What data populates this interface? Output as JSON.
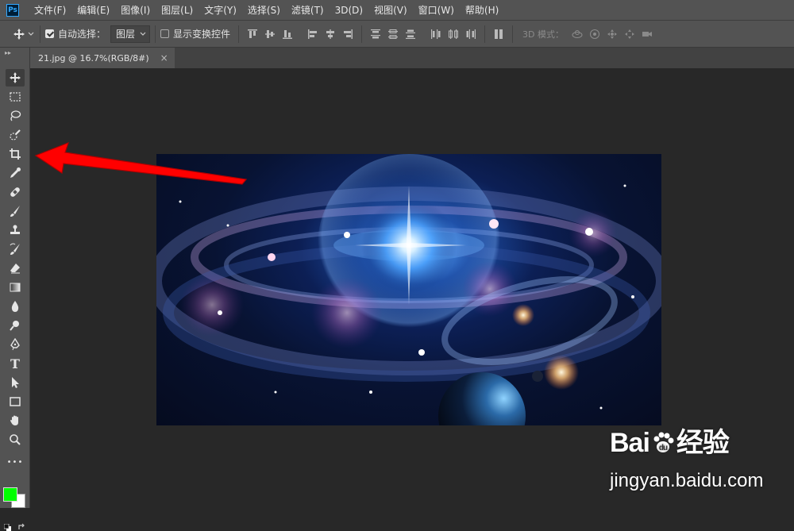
{
  "app": {
    "logo_text": "Ps"
  },
  "menu": [
    "文件(F)",
    "编辑(E)",
    "图像(I)",
    "图层(L)",
    "文字(Y)",
    "选择(S)",
    "滤镜(T)",
    "3D(D)",
    "视图(V)",
    "窗口(W)",
    "帮助(H)"
  ],
  "options": {
    "auto_select_label": "自动选择：",
    "auto_select_checked": true,
    "auto_select_value": "图层",
    "show_transform_label": "显示变换控件",
    "show_transform_checked": false,
    "mode_3d_label": "3D 模式："
  },
  "document_tab": {
    "title": "21.jpg @ 16.7%(RGB/8#)",
    "close_symbol": "×"
  },
  "tools": [
    "move-tool",
    "marquee-tool",
    "lasso-tool",
    "quick-select-tool",
    "crop-tool",
    "eyedropper-tool",
    "healing-brush-tool",
    "brush-tool",
    "stamp-tool",
    "history-brush-tool",
    "eraser-tool",
    "gradient-tool",
    "blur-tool",
    "dodge-tool",
    "pen-tool",
    "type-tool",
    "path-select-tool",
    "rectangle-tool",
    "hand-tool",
    "zoom-tool",
    "more-tools"
  ],
  "colors": {
    "foreground": "#00ff00",
    "background": "#ffffff",
    "annotation_arrow": "#ff0000"
  },
  "tool_labels": {
    "type": "T",
    "more": "•••"
  },
  "watermark": {
    "logo_prefix": "Bai",
    "logo_suffix": "经验",
    "url": "jingyan.baidu.com"
  }
}
